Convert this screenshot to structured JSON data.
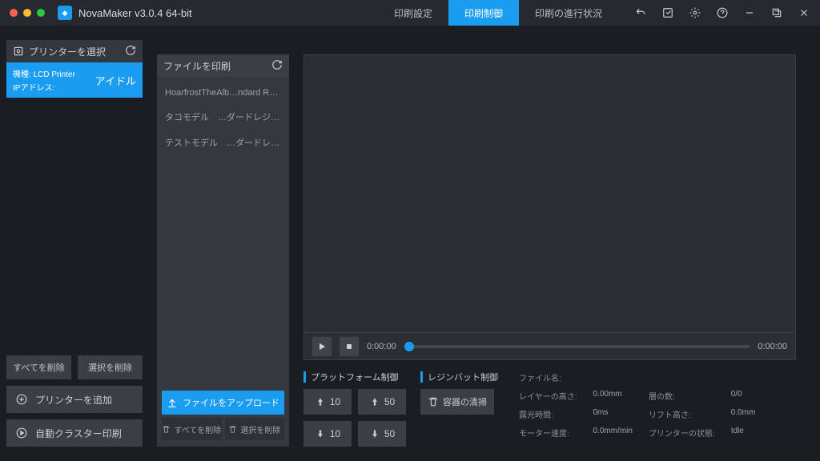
{
  "title": "NovaMaker v3.0.4 64-bit",
  "tabs": {
    "settings": "印刷設定",
    "control": "印刷制御",
    "progress": "印刷の進行状況"
  },
  "sidebar": {
    "header": "プリンターを選択",
    "printer": {
      "model_label": "機種:",
      "model": "LCD Printer",
      "ip_label": "IPアドレス:",
      "status": "アイドル"
    },
    "delete_all": "すべてを削除",
    "delete_sel": "選択を削除",
    "add_printer": "プリンターを追加",
    "auto_cluster": "自動クラスター印刷"
  },
  "files": {
    "header": "ファイルを印刷",
    "items": [
      "HoarfrostTheAlb…ndard Resin.ctb",
      "タコモデル　…ダードレジン.cws",
      "テストモデル　…ダードレジン.cws"
    ],
    "upload": "ファイルをアップロード",
    "delete_all": "すべてを削除",
    "delete_sel": "選択を削除"
  },
  "player": {
    "current": "0:00:00",
    "total": "0:00:00"
  },
  "controls": {
    "platform_header": "プラットフォーム制御",
    "vat_header": "レジンバット制御",
    "up10": "10",
    "up50": "50",
    "down10": "10",
    "down50": "50",
    "clean_vat": "容器の清掃"
  },
  "info": {
    "filename_label": "ファイル名:",
    "layer_h_label": "レイヤーの高さ:",
    "layer_h": "0.00mm",
    "layers_label": "層の数:",
    "layers": "0/0",
    "exposure_label": "露光時間:",
    "exposure": "0ms",
    "lift_label": "リフト高さ:",
    "lift": "0.0mm",
    "motor_label": "モーター速度:",
    "motor": "0.0mm/min",
    "printer_status_label": "プリンターの状態:",
    "printer_status": "Idle"
  }
}
